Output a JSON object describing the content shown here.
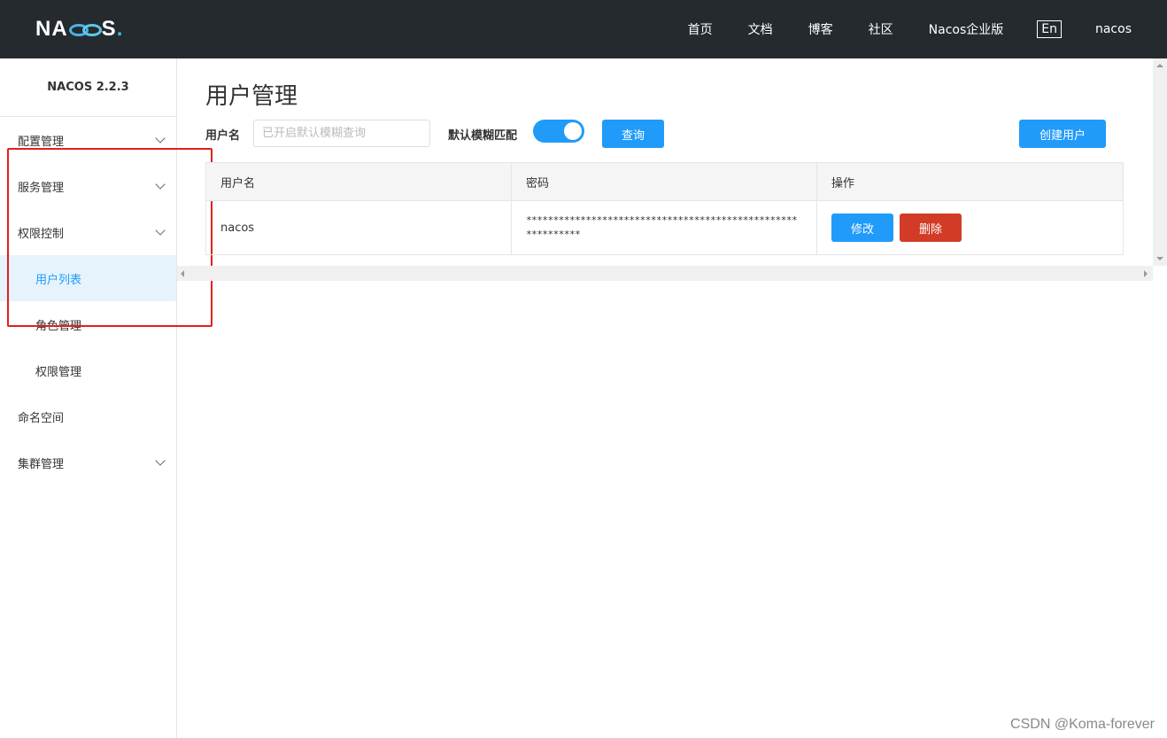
{
  "header": {
    "logo_text_left": "NA",
    "logo_text_right": "S",
    "logo_dot": ".",
    "nav": [
      "首页",
      "文档",
      "博客",
      "社区",
      "Nacos企业版"
    ],
    "lang": "En",
    "user": "nacos"
  },
  "sidebar": {
    "version": "NACOS 2.2.3",
    "items": [
      {
        "label": "配置管理"
      },
      {
        "label": "服务管理"
      },
      {
        "label": "权限控制"
      },
      {
        "label": "命名空间"
      },
      {
        "label": "集群管理"
      }
    ],
    "sub_items": [
      {
        "label": "用户列表",
        "active": true
      },
      {
        "label": "角色管理"
      },
      {
        "label": "权限管理"
      }
    ]
  },
  "main": {
    "title": "用户管理",
    "search": {
      "username_label": "用户名",
      "placeholder": "已开启默认模糊查询",
      "fuzzy_label": "默认模糊匹配",
      "fuzzy_enabled": true,
      "query_button": "查询",
      "create_button": "创建用户"
    },
    "table": {
      "columns": [
        "用户名",
        "密码",
        "操作"
      ],
      "rows": [
        {
          "username": "nacos",
          "password": "************************************************************",
          "edit": "修改",
          "delete": "删除"
        }
      ]
    }
  },
  "watermark": "CSDN @Koma-forever",
  "colors": {
    "topbar": "#252a2f",
    "primary": "#209bfa",
    "danger": "#d23c26",
    "highlight": "#e0201d"
  }
}
